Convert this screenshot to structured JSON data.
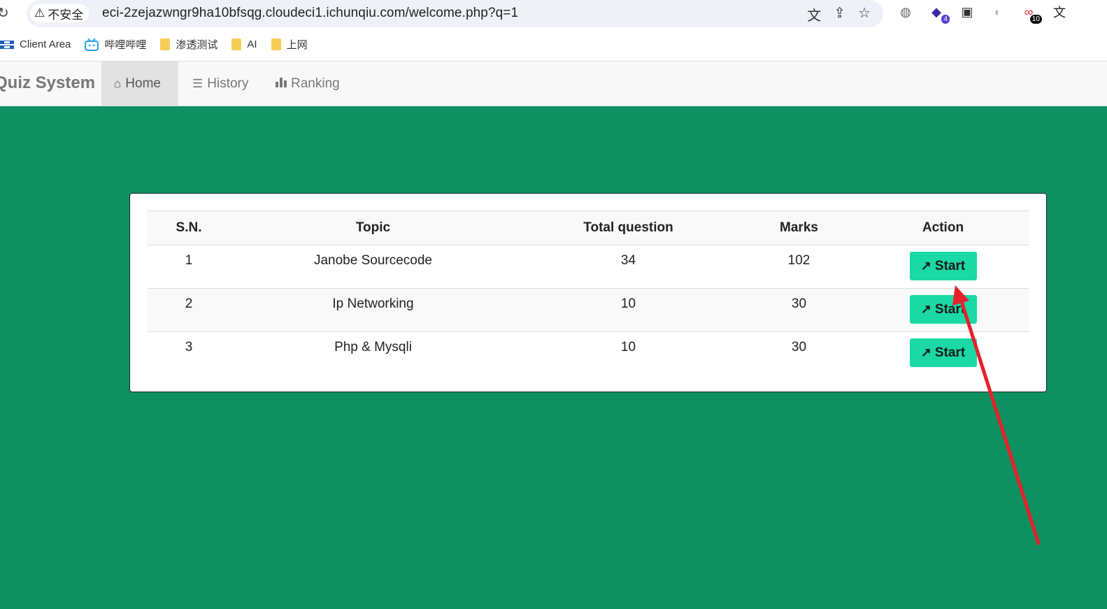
{
  "browser": {
    "security_label": "不安全",
    "url": "eci-2zejazwngr9ha10bfsqg.cloudeci1.ichunqiu.com/welcome.php?q=1",
    "extension_badges": [
      "4",
      "10"
    ]
  },
  "bookmarks": [
    {
      "label": "Client Area",
      "icon": "client-area-icon"
    },
    {
      "label": "哔哩哔哩",
      "icon": "bilibili-icon"
    },
    {
      "label": "渗透测试",
      "icon": "folder-icon"
    },
    {
      "label": "AI",
      "icon": "folder-icon"
    },
    {
      "label": "上网",
      "icon": "folder-icon"
    }
  ],
  "navbar": {
    "brand": "Quiz System",
    "items": [
      {
        "label": "Home",
        "icon": "home-icon",
        "active": true
      },
      {
        "label": "History",
        "icon": "list-icon",
        "active": false
      },
      {
        "label": "Ranking",
        "icon": "bar-chart-icon",
        "active": false
      }
    ]
  },
  "table": {
    "headers": [
      "S.N.",
      "Topic",
      "Total question",
      "Marks",
      "Action"
    ],
    "rows": [
      {
        "sn": "1",
        "topic": "Janobe Sourcecode",
        "total": "34",
        "marks": "102",
        "action": "Start"
      },
      {
        "sn": "2",
        "topic": "Ip Networking",
        "total": "10",
        "marks": "30",
        "action": "Start"
      },
      {
        "sn": "3",
        "topic": "Php & Mysqli",
        "total": "10",
        "marks": "30",
        "action": "Start"
      }
    ]
  },
  "colors": {
    "page_background": "#0d9162",
    "start_button": "#1ad9a5",
    "annotation_arrow": "#e8202a"
  }
}
